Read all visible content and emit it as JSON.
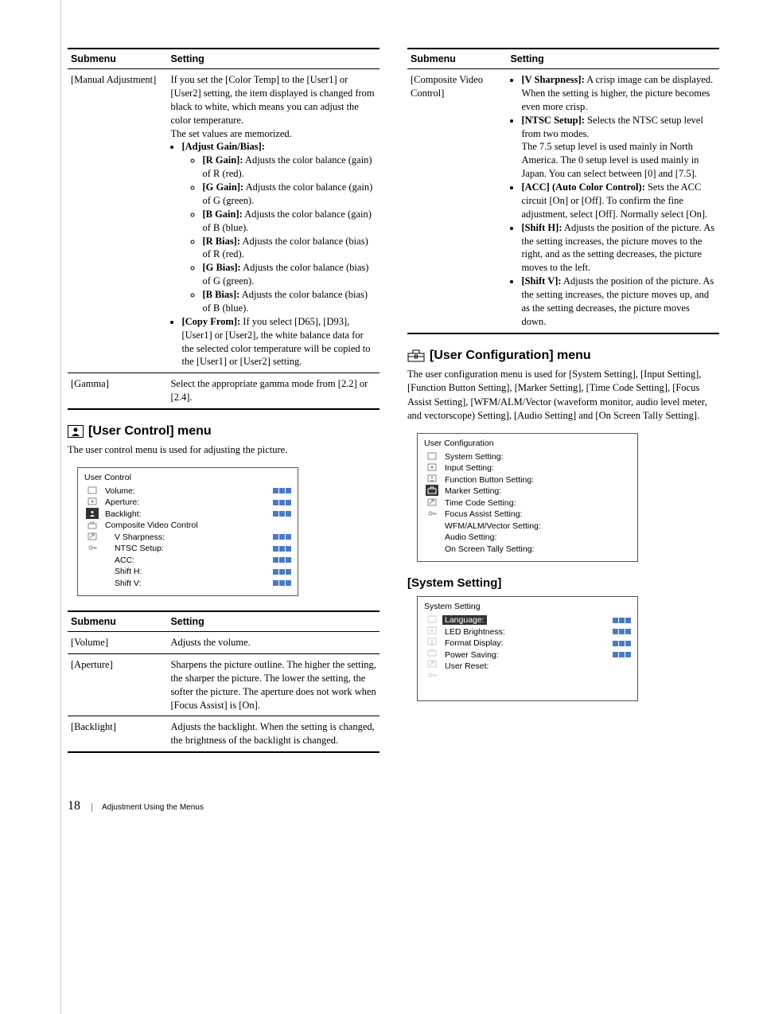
{
  "headers": {
    "submenu": "Submenu",
    "setting": "Setting"
  },
  "left_table1": {
    "r1_sub": "[Manual Adjustment]",
    "r1_set_intro": "If you set the [Color Temp] to the [User1] or [User2] setting, the item displayed is changed from black to white, which means you can adjust the color temperature.",
    "r1_set_mem": "The set values are memorized.",
    "r1_li1_label": "[Adjust Gain/Bias]:",
    "r1_s1_b": "[R Gain]:",
    "r1_s1_t": " Adjusts the color balance (gain) of R (red).",
    "r1_s2_b": "[G Gain]:",
    "r1_s2_t": " Adjusts the color balance (gain) of G (green).",
    "r1_s3_b": "[B Gain]:",
    "r1_s3_t": " Adjusts the color balance (gain) of B (blue).",
    "r1_s4_b": "[R Bias]:",
    "r1_s4_t": " Adjusts the color balance (bias) of R (red).",
    "r1_s5_b": "[G Bias]:",
    "r1_s5_t": " Adjusts the color balance (bias) of G (green).",
    "r1_s6_b": "[B Bias]:",
    "r1_s6_t": " Adjusts the color balance (bias) of B (blue).",
    "r1_li2_b": "[Copy From]:",
    "r1_li2_t": " If you select [D65], [D93], [User1] or [User2], the white balance data for the selected color temperature will be copied to the [User1] or [User2] setting.",
    "r2_sub": "[Gamma]",
    "r2_set": "Select the appropriate gamma mode from [2.2] or [2.4]."
  },
  "user_control_heading": "[User Control] menu",
  "user_control_desc": "The user control menu is used for adjusting the picture.",
  "osd_uc": {
    "title": "User Control",
    "rows": [
      {
        "label": "Volume:",
        "ind": true
      },
      {
        "label": "Aperture:",
        "ind": true
      },
      {
        "label": "Backlight:",
        "ind": true
      },
      {
        "label": "Composite Video Control",
        "ind": false
      },
      {
        "label": "V Sharpness:",
        "ind": true,
        "indent": true
      },
      {
        "label": "NTSC Setup:",
        "ind": true,
        "indent": true
      },
      {
        "label": "ACC:",
        "ind": true,
        "indent": true
      },
      {
        "label": "Shift H:",
        "ind": true,
        "indent": true
      },
      {
        "label": "Shift V:",
        "ind": true,
        "indent": true
      }
    ]
  },
  "left_table2": {
    "r1_sub": "[Volume]",
    "r1_set": "Adjusts the volume.",
    "r2_sub": "[Aperture]",
    "r2_set": "Sharpens the picture outline. The higher the setting, the sharper the picture. The lower the setting, the softer the picture. The aperture does not work when [Focus Assist] is [On].",
    "r3_sub": "[Backlight]",
    "r3_set": "Adjusts the backlight. When the setting is changed, the brightness of the backlight is changed."
  },
  "right_table": {
    "r1_sub": "[Composite Video Control]",
    "vs_b": "[V Sharpness]:",
    "vs_t": " A crisp image can be displayed.",
    "vs_extra": "When the setting is higher, the picture becomes even more crisp.",
    "ntsc_b": "[NTSC Setup]:",
    "ntsc_t": " Selects the NTSC setup level from two modes.",
    "ntsc_extra": "The 7.5 setup level is used mainly in North America. The 0 setup level is used mainly in Japan. You can select between [0] and [7.5].",
    "acc_b": "[ACC] (Auto Color Control):",
    "acc_t": " Sets the ACC circuit [On] or [Off]. To confirm the fine adjustment, select [Off]. Normally select [On].",
    "sh_b": "[Shift H]:",
    "sh_t": " Adjusts the position of the picture. As the setting increases, the picture moves to the right, and as the setting decreases, the picture moves to the left.",
    "sv_b": "[Shift V]:",
    "sv_t": " Adjusts the position of the picture. As the setting increases, the picture moves up, and as the setting decreases, the picture moves down."
  },
  "user_config_heading": "[User Configuration] menu",
  "user_config_desc": "The user configuration menu is used for [System Setting], [Input Setting], [Function Button Setting], [Marker Setting], [Time Code Setting], [Focus Assist Setting], [WFM/ALM/Vector (waveform monitor, audio level meter, and vectorscope) Setting], [Audio Setting] and [On Screen Tally Setting].",
  "osd_ucfg": {
    "title": "User Configuration",
    "rows": [
      {
        "label": "System Setting:"
      },
      {
        "label": "Input Setting:"
      },
      {
        "label": "Function Button Setting:"
      },
      {
        "label": "Marker Setting:"
      },
      {
        "label": "Time Code Setting:"
      },
      {
        "label": "Focus Assist Setting:"
      },
      {
        "label": "WFM/ALM/Vector Setting:"
      },
      {
        "label": "Audio Setting:"
      },
      {
        "label": "On Screen Tally Setting:"
      }
    ]
  },
  "system_setting_heading": "[System Setting]",
  "osd_sys": {
    "title": "System Setting",
    "rows": [
      {
        "label": "Language:",
        "ind": true,
        "sel": true
      },
      {
        "label": "LED Brightness:",
        "ind": true
      },
      {
        "label": "Format Display:",
        "ind": true
      },
      {
        "label": "Power Saving:",
        "ind": true
      },
      {
        "label": "User Reset:",
        "ind": false
      }
    ]
  },
  "footer": {
    "page": "18",
    "title": "Adjustment Using the Menus"
  }
}
